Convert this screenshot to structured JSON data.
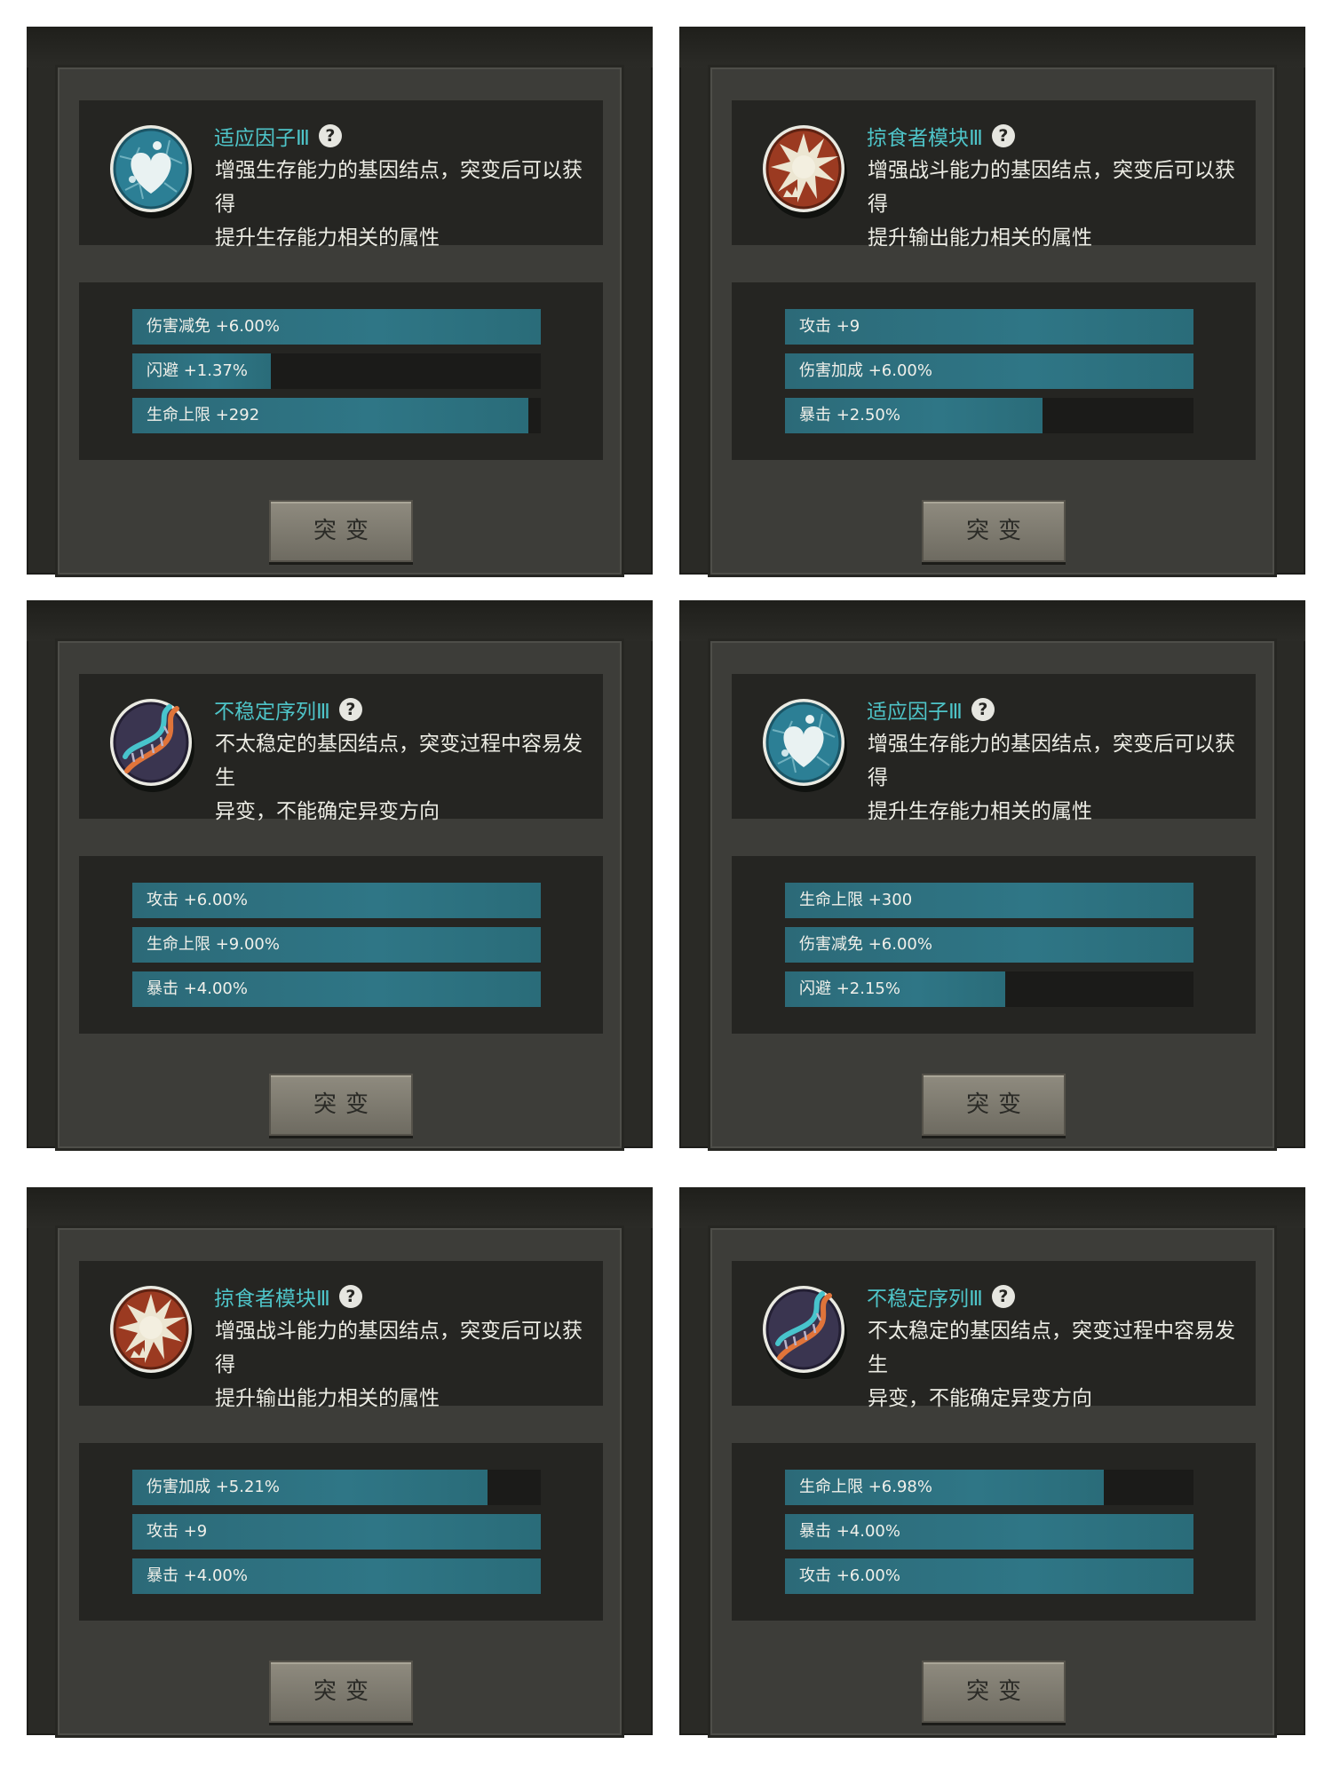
{
  "cards": [
    {
      "icon": "heart-cell-icon",
      "title": "适应因子Ⅲ",
      "help": "?",
      "desc1": "增强生存能力的基因结点，突变后可以获得",
      "desc2": "提升生存能力相关的属性",
      "stats": [
        {
          "label": "伤害减免 +6.00%",
          "fill": 1.0
        },
        {
          "label": "闪避 +1.37%",
          "fill": 0.34
        },
        {
          "label": "生命上限 +292",
          "fill": 0.97
        }
      ],
      "button": "突变"
    },
    {
      "icon": "predator-burst-icon",
      "title": "掠食者模块Ⅲ",
      "help": "?",
      "desc1": "增强战斗能力的基因结点，突变后可以获得",
      "desc2": "提升输出能力相关的属性",
      "stats": [
        {
          "label": "攻击 +9",
          "fill": 1.0
        },
        {
          "label": "伤害加成 +6.00%",
          "fill": 1.0
        },
        {
          "label": "暴击 +2.50%",
          "fill": 0.63
        }
      ],
      "button": "突变"
    },
    {
      "icon": "dna-helix-icon",
      "title": "不稳定序列Ⅲ",
      "help": "?",
      "desc1": "不太稳定的基因结点，突变过程中容易发生",
      "desc2": "异变，不能确定异变方向",
      "stats": [
        {
          "label": "攻击 +6.00%",
          "fill": 1.0
        },
        {
          "label": "生命上限 +9.00%",
          "fill": 1.0
        },
        {
          "label": "暴击 +4.00%",
          "fill": 1.0
        }
      ],
      "button": "突变"
    },
    {
      "icon": "heart-cell-icon",
      "title": "适应因子Ⅲ",
      "help": "?",
      "desc1": "增强生存能力的基因结点，突变后可以获得",
      "desc2": "提升生存能力相关的属性",
      "stats": [
        {
          "label": "生命上限 +300",
          "fill": 1.0
        },
        {
          "label": "伤害减免 +6.00%",
          "fill": 1.0
        },
        {
          "label": "闪避 +2.15%",
          "fill": 0.54
        }
      ],
      "button": "突变"
    },
    {
      "icon": "predator-burst-icon",
      "title": "掠食者模块Ⅲ",
      "help": "?",
      "desc1": "增强战斗能力的基因结点，突变后可以获得",
      "desc2": "提升输出能力相关的属性",
      "stats": [
        {
          "label": "伤害加成 +5.21%",
          "fill": 0.87
        },
        {
          "label": "攻击 +9",
          "fill": 1.0
        },
        {
          "label": "暴击 +4.00%",
          "fill": 1.0
        }
      ],
      "button": "突变"
    },
    {
      "icon": "dna-helix-icon",
      "title": "不稳定序列Ⅲ",
      "help": "?",
      "desc1": "不太稳定的基因结点，突变过程中容易发生",
      "desc2": "异变，不能确定异变方向",
      "stats": [
        {
          "label": "生命上限 +6.98%",
          "fill": 0.78
        },
        {
          "label": "暴击 +4.00%",
          "fill": 1.0
        },
        {
          "label": "攻击 +6.00%",
          "fill": 1.0
        }
      ],
      "button": "突变"
    }
  ]
}
